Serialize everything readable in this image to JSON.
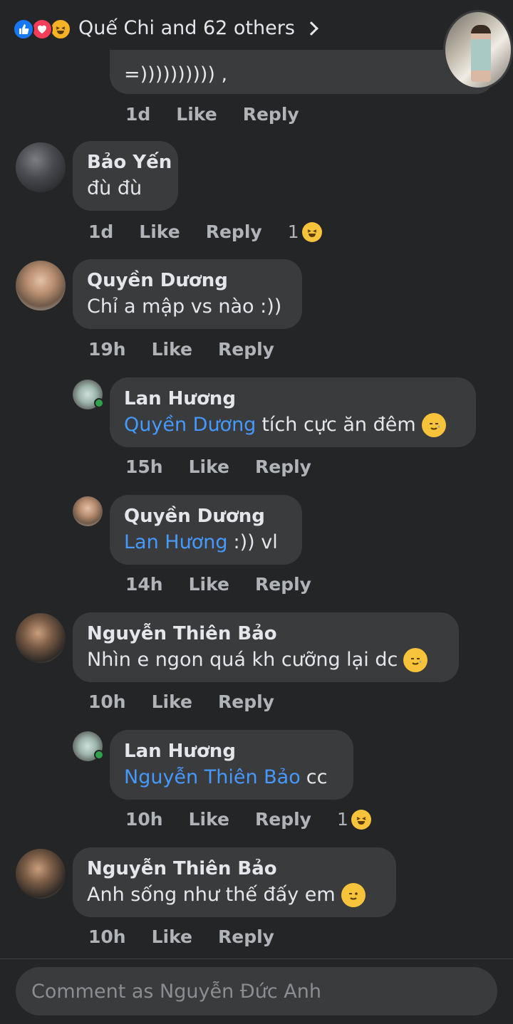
{
  "top": {
    "reaction_summary": "Quế Chi and 62 others"
  },
  "first_comment_partial": {
    "text": "=)))))))))) ,",
    "time": "1d",
    "like": "Like",
    "reply": "Reply"
  },
  "comments": [
    {
      "author": "Bảo Yến",
      "text": "đù đù",
      "time": "1d",
      "like": "Like",
      "reply": "Reply",
      "reaction_count": "1"
    },
    {
      "author": "Quyền Dương",
      "text": "Chỉ a mập vs nào :))",
      "time": "19h",
      "like": "Like",
      "reply": "Reply"
    },
    {
      "author": "Lan Hương",
      "mention": "Quyền Dương",
      "text": "tích cực ăn đêm",
      "time": "15h",
      "like": "Like",
      "reply": "Reply"
    },
    {
      "author": "Quyền Dương",
      "mention": "Lan Hương",
      "text": ":)) vl",
      "time": "14h",
      "like": "Like",
      "reply": "Reply"
    },
    {
      "author": "Nguyễn Thiên Bảo",
      "text": "Nhìn e ngon quá kh cưỡng lại dc",
      "time": "10h",
      "like": "Like",
      "reply": "Reply"
    },
    {
      "author": "Lan Hương",
      "mention": "Nguyễn Thiên Bảo",
      "text": "cc",
      "time": "10h",
      "like": "Like",
      "reply": "Reply",
      "reaction_count": "1"
    },
    {
      "author": "Nguyễn Thiên Bảo",
      "text": "Anh sống như thế đấy em",
      "time": "10h",
      "like": "Like",
      "reply": "Reply"
    }
  ],
  "composer": {
    "placeholder": "Comment as Nguyễn Đức Anh"
  },
  "colors": {
    "background": "#242526",
    "bubble": "#3a3b3c",
    "mention": "#4599ff",
    "muted": "#b0b3b8"
  }
}
